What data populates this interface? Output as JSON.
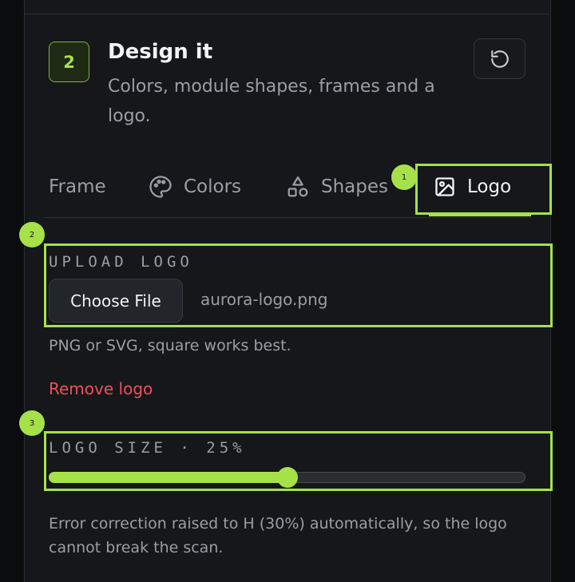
{
  "step": {
    "number": "2",
    "title": "Design it",
    "subtitle": "Colors, module shapes, frames and a logo."
  },
  "tabs": [
    {
      "label": "Frame",
      "icon": "none"
    },
    {
      "label": "Colors",
      "icon": "palette-icon"
    },
    {
      "label": "Shapes",
      "icon": "shapes-icon"
    },
    {
      "label": "Logo",
      "icon": "image-icon",
      "active": true
    }
  ],
  "markers": [
    "1",
    "2",
    "3"
  ],
  "upload": {
    "label": "UPLOAD LOGO",
    "button": "Choose File",
    "filename": "aurora-logo.png",
    "hint": "PNG or SVG, square works best.",
    "remove": "Remove logo"
  },
  "size": {
    "label": "LOGO SIZE · 25%",
    "slider_fraction": 0.5
  },
  "note": "Error correction raised to H (30%) automatically, so the logo cannot break the scan.",
  "colors": {
    "accent": "#a6e14a",
    "danger": "#f0505a",
    "panel": "#15171a"
  }
}
